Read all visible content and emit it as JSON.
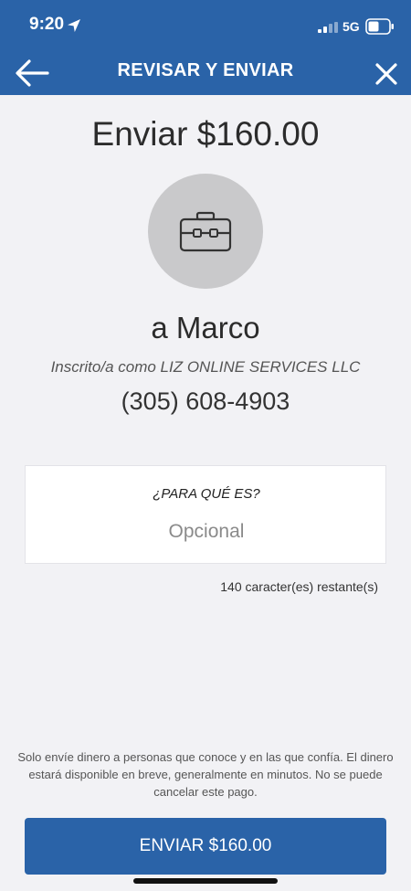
{
  "status_bar": {
    "time": "9:20",
    "network": "5G"
  },
  "header": {
    "title": "REVISAR Y ENVIAR"
  },
  "payment": {
    "amount_title": "Enviar $160.00",
    "recipient_name": "a Marco",
    "enrolled_as": "Inscrito/a como LIZ ONLINE SERVICES LLC",
    "phone": "(305) 608-4903"
  },
  "memo": {
    "label": "¿PARA QUÉ ES?",
    "value": "",
    "placeholder": "Opcional",
    "chars_remaining": "140 caracter(es) restante(s)"
  },
  "disclaimer": "Solo envíe dinero a personas que conoce y en las que confía. El dinero estará disponible en breve, generalmente en minutos. No se puede cancelar este pago.",
  "send_button_label": "ENVIAR $160.00",
  "icons": {
    "back": "arrow-left-icon",
    "close": "close-icon",
    "avatar": "briefcase-icon",
    "location": "location-arrow-icon",
    "signal": "signal-icon",
    "battery": "battery-icon"
  },
  "colors": {
    "primary": "#2a63a8",
    "background": "#f2f2f5",
    "avatar_bg": "#c9c9cb"
  }
}
